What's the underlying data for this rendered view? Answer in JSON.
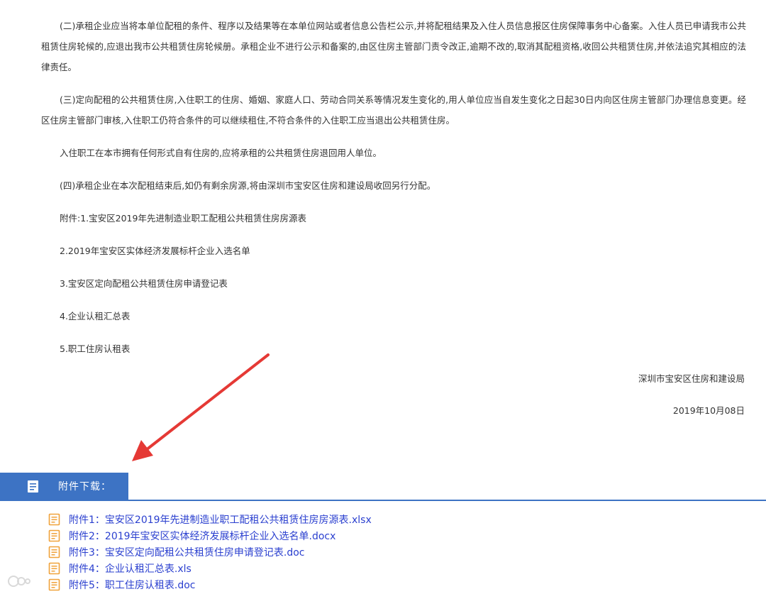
{
  "article": {
    "paragraphs": [
      "(二)承租企业应当将本单位配租的条件、程序以及结果等在本单位网站或者信息公告栏公示,并将配租结果及入住人员信息报区住房保障事务中心备案。入住人员已申请我市公共租赁住房轮候的,应退出我市公共租赁住房轮候册。承租企业不进行公示和备案的,由区住房主管部门责令改正,逾期不改的,取消其配租资格,收回公共租赁住房,并依法追究其相应的法律责任。",
      "(三)定向配租的公共租赁住房,入住职工的住房、婚姻、家庭人口、劳动合同关系等情况发生变化的,用人单位应当自发生变化之日起30日内向区住房主管部门办理信息变更。经区住房主管部门审核,入住职工仍符合条件的可以继续租住,不符合条件的入住职工应当退出公共租赁住房。"
    ],
    "lines": [
      "入住职工在本市拥有任何形式自有住房的,应将承租的公共租赁住房退回用人单位。",
      "(四)承租企业在本次配租结束后,如仍有剩余房源,将由深圳市宝安区住房和建设局收回另行分配。",
      "附件:1.宝安区2019年先进制造业职工配租公共租赁住房房源表",
      "2.2019年宝安区实体经济发展标杆企业入选名单",
      "3.宝安区定向配租公共租赁住房申请登记表",
      "4.企业认租汇总表",
      "5.职工住房认租表"
    ],
    "signature_org": "深圳市宝安区住房和建设局",
    "signature_date": "2019年10月08日"
  },
  "downloads": {
    "title": "附件下载：",
    "icon": "document-icon",
    "items": [
      "附件1：宝安区2019年先进制造业职工配租公共租赁住房房源表.xlsx",
      "附件2：2019年宝安区实体经济发展标杆企业入选名单.docx",
      "附件3：宝安区定向配租公共租赁住房申请登记表.doc",
      "附件4：企业认租汇总表.xls",
      "附件5：职工住房认租表.doc"
    ]
  },
  "colors": {
    "accent": "#3d73c4",
    "link": "#2a3fcf",
    "arrow": "#e53935",
    "file_icon": "#f0a23a"
  }
}
